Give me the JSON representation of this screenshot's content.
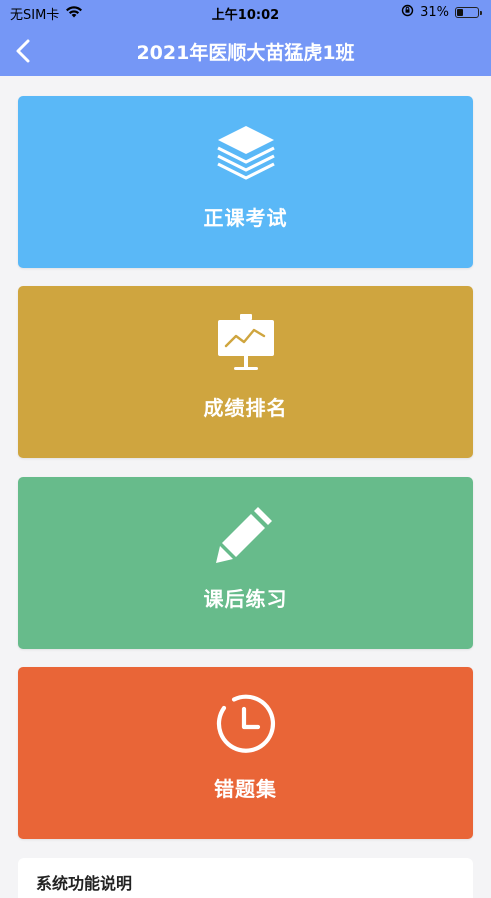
{
  "status_bar": {
    "carrier": "无SIM卡",
    "time": "上午10:02",
    "battery_text": "31%",
    "battery_level": 0.31
  },
  "header": {
    "back_icon": "chevron-left-icon",
    "title": "2021年医顺大苗猛虎1班"
  },
  "menu": [
    {
      "label": "正课考试",
      "icon": "layers-icon",
      "color": "#5ab8f7"
    },
    {
      "label": "成绩排名",
      "icon": "presentation-chart-icon",
      "color": "#cfa53f"
    },
    {
      "label": "课后练习",
      "icon": "pencil-icon",
      "color": "#67bb8b"
    },
    {
      "label": "错题集",
      "icon": "clock-icon",
      "color": "#e96537"
    }
  ],
  "bottom_panel": {
    "title": "系统功能说明"
  }
}
